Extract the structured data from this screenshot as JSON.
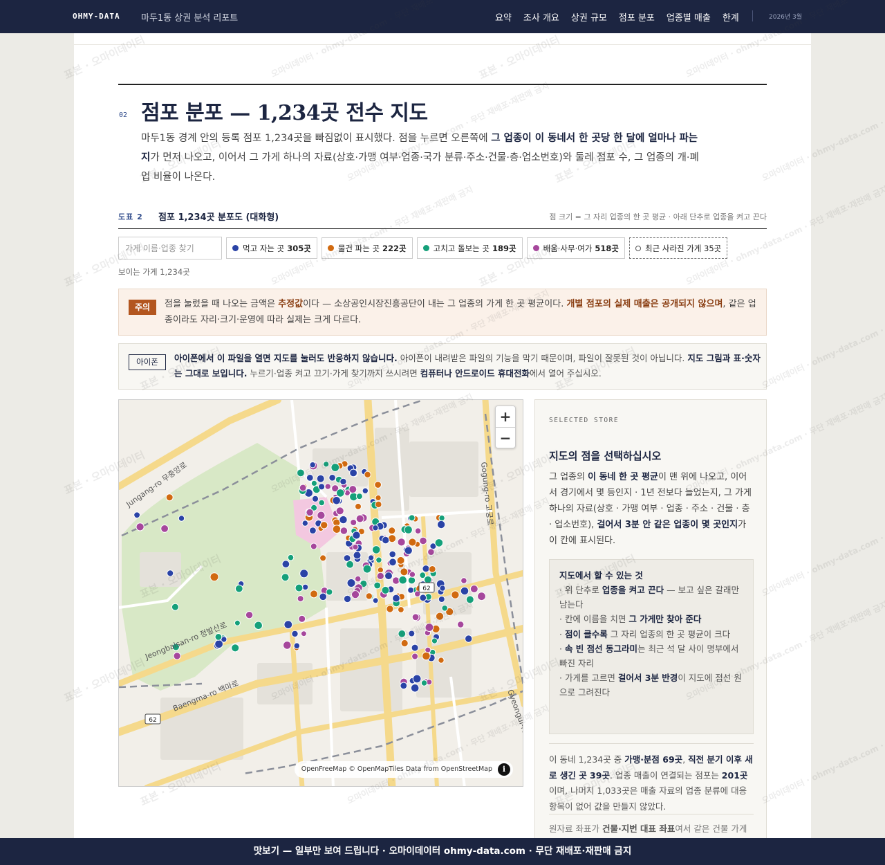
{
  "header": {
    "brand": "OHMY-DATA",
    "report_title": "마두1동 상권 분석 리포트",
    "nav": [
      "요약",
      "조사 개요",
      "상권 규모",
      "점포 분포",
      "업종별 매출",
      "한계"
    ],
    "date": "2026년 3월"
  },
  "section": {
    "number": "02",
    "title": "점포 분포 — 1,234곳 전수 지도",
    "lead_1": "마두1동 경계 안의 등록 점포 1,234곳을 빠짐없이 표시했다. 점을 누르면 오른쪽에 ",
    "lead_b1": "그 업종이 이 동네서 한 곳당 한 달에 얼마나 파는지",
    "lead_2": "가 먼저 나오고, 이어서 그 가게 하나의 자료(상호·가맹 여부·업종·국가 분류·주소·건물·층·업소번호)와 둘레 점포 수, 그 업종의 개·폐업 비율이 나온다."
  },
  "figure": {
    "number": "도표 2",
    "title": "점포 1,234곳 분포도 (대화형)",
    "note": "점 크기 = 그 자리 업종의 한 곳 평균 · 아래 단추로 업종을 켜고 끈다"
  },
  "search": {
    "placeholder": "가게 이름·업종 찾기"
  },
  "filters": [
    {
      "label": "먹고 자는 곳",
      "count": "305곳",
      "color": "#2a43a6"
    },
    {
      "label": "물건 파는 곳",
      "count": "222곳",
      "color": "#d16a10"
    },
    {
      "label": "고치고 돌보는 곳",
      "count": "189곳",
      "color": "#15a07a"
    },
    {
      "label": "배움·사무·여가",
      "count": "518곳",
      "color": "#a6479c"
    }
  ],
  "closed_filter": {
    "label": "최근 사라진 가게 35곳"
  },
  "visible_count": "보이는 가게 1,234곳",
  "notice": {
    "tag": "주의",
    "t1": "점을 눌렀을 때 나오는 금액은 ",
    "b1": "추정값",
    "t2": "이다 — 소상공인시장진흥공단이 내는 그 업종의 가게 한 곳 평균이다. ",
    "b2": "개별 점포의 실제 매출은 공개되지 않으며",
    "t3": ", 같은 업종이라도 자리·크기·운영에 따라 실제는 크게 다르다."
  },
  "iphone": {
    "tag": "아이폰",
    "b1": "아이폰에서 이 파일을 열면 지도를 눌러도 반응하지 않습니다.",
    "t1": " 아이폰이 내려받은 파일의 기능을 막기 때문이며, 파일이 잘못된 것이 아닙니다. ",
    "b2": "지도 그림과 표·숫자는 그대로 보입니다.",
    "t2": " 누르기·업종 켜고 끄기·가게 찾기까지 쓰시려면 ",
    "b3": "컴퓨터나 안드로이드 휴대전화",
    "t3": "에서 열어 주십시오."
  },
  "map": {
    "zoom_in": "+",
    "zoom_out": "−",
    "attribution": "OpenFreeMap © OpenMapTiles Data from OpenStreetMap",
    "info": "i",
    "roads": [
      "Jungang-ro 무중앙로",
      "Jeongbalsan-ro 정발산로",
      "Baengma-ro 백마로",
      "Gogung-ro 고궁로",
      "Gyeongui-ro"
    ],
    "shield_1": "62",
    "shield_2": "62"
  },
  "panel": {
    "eyebrow": "SELECTED STORE",
    "title": "지도의 점을 선택하십시오",
    "d1": "그 업종의 ",
    "db1": "이 동네 한 곳 평균",
    "d2": "이 맨 위에 나오고, 이어서 경기에서 몇 등인지 · 1년 전보다 늘었는지, 그 가게 하나의 자료(상호 · 가맹 여부 · 업종 · 주소 · 건물 · 층 · 업소번호), ",
    "db2": "걸어서 3분 안 같은 업종이 몇 곳인지",
    "d3": "가 이 칸에 표시된다.",
    "howto_title": "지도에서 할 수 있는 것",
    "h1a": "· 위 단추로 ",
    "h1b": "업종을 켜고 끈다",
    "h1c": " — 보고 싶은 갈래만 남는다",
    "h2a": "· 칸에 이름을 치면 ",
    "h2b": "그 가게만 찾아 준다",
    "h3a": "· ",
    "h3b": "점이 클수록",
    "h3c": " 그 자리 업종의 한 곳 평균이 크다",
    "h4a": "· ",
    "h4b": "속 빈 점선 동그라미",
    "h4c": "는 최근 석 달 사이 명부에서 빠진 자리",
    "h5a": "· 가게를 고르면 ",
    "h5b": "걸어서 3분 반경",
    "h5c": "이 지도에 점선 원으로 그려진다",
    "s1": "이 동네 1,234곳 중 ",
    "sb1": "가맹·분점 69곳",
    "s2": ", ",
    "sb2": "직전 분기 이후 새로 생긴 곳 39곳",
    "s3": ". 업종 매출이 연결되는 점포는 ",
    "sb3": "201곳",
    "s4": "이며, 나머지 1,033곳은 매출 자료의 업종 분류에 대응 항목이 없어 값을 만들지 않았다.",
    "f1": "원자료 좌표가 ",
    "fb1": "건물·지번 대표 좌표",
    "f2": "여서 같은 건물 가게들은 지도에서 한 점으로 겹친다. 겹친 자리는"
  },
  "footer": {
    "text": "맛보기 — 일부만 보여 드립니다 · 오마이데이터 ohmy-data.com · 무단 재배포·재판매 금지"
  },
  "watermark": {
    "a": "표본 · 오마이데이터",
    "b": "오마이데이터 · ohmy-data.com · 무단 재배포·재판매 금지"
  }
}
